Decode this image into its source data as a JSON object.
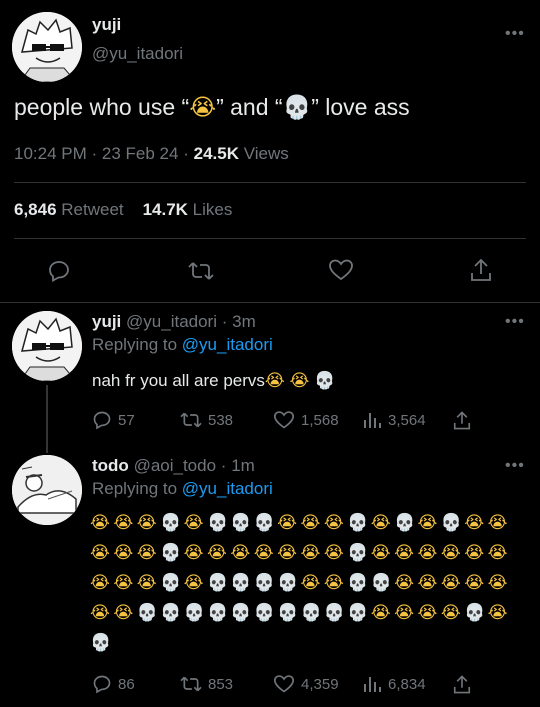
{
  "main_tweet": {
    "display_name": "yuji",
    "handle": "@yu_itadori",
    "text_parts": [
      "people who use “",
      "😭",
      "” and “",
      "💀",
      "” love ass"
    ],
    "time": "10:24 PM",
    "sep1": "·",
    "date": "23 Feb 24",
    "sep2": "·",
    "views_count": "24.5K",
    "views_label": "Views",
    "retweets_count": "6,846",
    "retweets_label": "Retweet",
    "likes_count": "14.7K",
    "likes_label": "Likes",
    "more": "•••"
  },
  "reply1": {
    "display_name": "yuji",
    "handle": "@yu_itadori",
    "sep": "·",
    "time": "3m",
    "replying_to_label": "Replying to",
    "replying_to_handle": "@yu_itadori",
    "text": "nah fr you all are pervs",
    "text_emojis": [
      "😭",
      "😭",
      "💀"
    ],
    "replies": "57",
    "retweets": "538",
    "likes": "1,568",
    "views": "3,564",
    "more": "•••"
  },
  "reply2": {
    "display_name": "todo",
    "handle": "@aoi_todo",
    "sep": "·",
    "time": "1m",
    "replying_to_label": "Replying to",
    "replying_to_handle": "@yu_itadori",
    "emoji_rows": [
      "CCCSCSSSCCCSCSCSCC",
      "CCCSCCCCCCCSCCCCCC",
      "CCCSCSSSSCCSSCCCCC",
      "CCSSSSSSSSSSCCCCSC",
      "S"
    ],
    "emoji_map": {
      "C": "😭",
      "S": "💀"
    },
    "replies": "86",
    "retweets": "853",
    "likes": "4,359",
    "views": "6,834",
    "more": "•••"
  },
  "colors": {
    "background": "#000000",
    "text": "#e7e9ea",
    "muted": "#71767b",
    "link": "#1d9bf0",
    "divider": "#2f3336"
  },
  "icons": [
    "reply-icon",
    "retweet-icon",
    "like-icon",
    "share-icon",
    "views-icon",
    "more-icon"
  ]
}
